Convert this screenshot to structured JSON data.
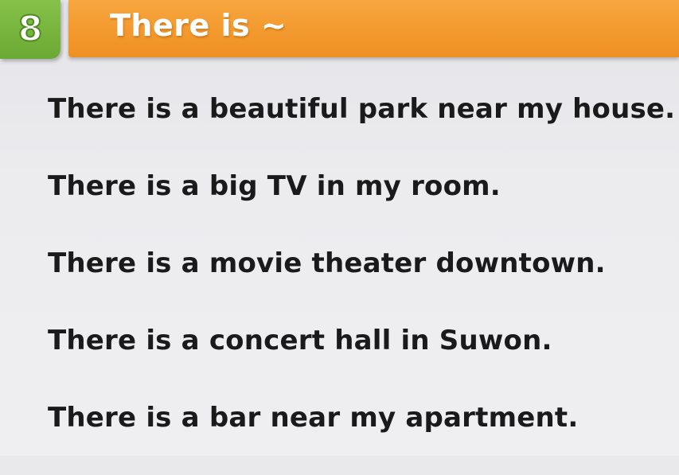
{
  "badge": {
    "number": "8"
  },
  "header": {
    "title": "There is ~"
  },
  "sentences": [
    {
      "text": "There is a beautiful park near my house."
    },
    {
      "text": "There is a big TV in my room."
    },
    {
      "text": "There is a movie theater downtown."
    },
    {
      "text": "There is a concert hall in Suwon."
    },
    {
      "text": "There is a bar near my apartment."
    }
  ],
  "colors": {
    "badge_green": "#7ab83f",
    "title_orange": "#f39a2e",
    "text": "#1a1a1a",
    "background": "#ececef"
  }
}
